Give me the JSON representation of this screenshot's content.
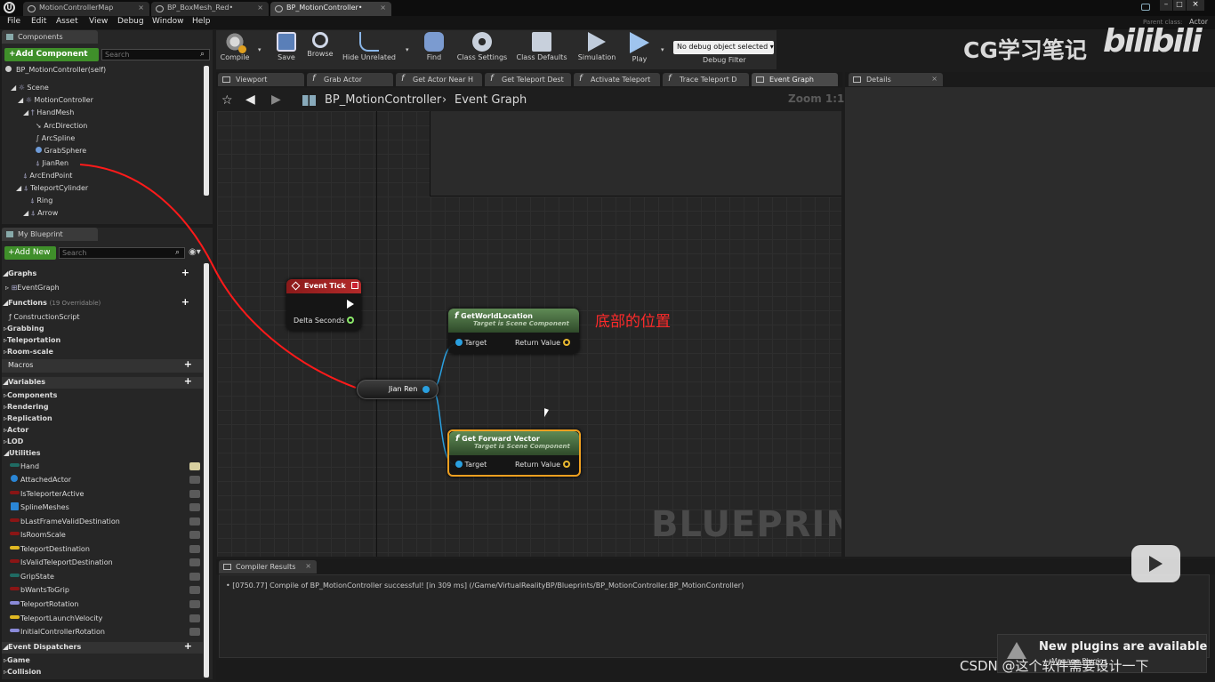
{
  "doc_tabs": [
    "MotionControllerMap",
    "BP_BoxMesh_Red•",
    "BP_MotionController•"
  ],
  "title_right": {
    "parent_class_label": "Parent class:",
    "parent_class_value": "Actor"
  },
  "menu": [
    "File",
    "Edit",
    "Asset",
    "View",
    "Debug",
    "Window",
    "Help"
  ],
  "components": {
    "tab": "Components",
    "add_button": "+Add Component",
    "search_placeholder": "Search",
    "self_label": "BP_MotionController(self)",
    "tree": [
      "Scene",
      "MotionController",
      "HandMesh",
      "ArcDirection",
      "ArcSpline",
      "GrabSphere",
      "JianRen",
      "ArcEndPoint",
      "TeleportCylinder",
      "Ring",
      "Arrow"
    ]
  },
  "my_blueprint": {
    "tab": "My Blueprint",
    "add_button": "+Add New",
    "search_placeholder": "Search",
    "graphs_label": "Graphs",
    "event_graph": "EventGraph",
    "functions_label": "Functions",
    "functions_count": "(19 Overridable)",
    "construction_script": "ConstructionScript",
    "function_categories": [
      "Grabbing",
      "Teleportation",
      "Room-scale"
    ],
    "macros_label": "Macros",
    "variables_label": "Variables",
    "variable_categories": [
      "Components",
      "Rendering",
      "Replication",
      "Actor",
      "LOD",
      "Utilities"
    ],
    "variables": [
      {
        "name": "Hand",
        "color": "#1f6b63"
      },
      {
        "name": "AttachedActor",
        "color": "#2a86d6"
      },
      {
        "name": "IsTeleporterActive",
        "color": "#8a1515"
      },
      {
        "name": "SplineMeshes",
        "color": "#2a86d6"
      },
      {
        "name": "bLastFrameValidDestination",
        "color": "#8a1515"
      },
      {
        "name": "IsRoomScale",
        "color": "#8a1515"
      },
      {
        "name": "TeleportDestination",
        "color": "#e0b822"
      },
      {
        "name": "IsValidTeleportDestination",
        "color": "#8a1515"
      },
      {
        "name": "GripState",
        "color": "#1f6b63"
      },
      {
        "name": "bWantsToGrip",
        "color": "#8a1515"
      },
      {
        "name": "TeleportRotation",
        "color": "#8a8ad8"
      },
      {
        "name": "TeleportLaunchVelocity",
        "color": "#e0b822"
      },
      {
        "name": "InitialControllerRotation",
        "color": "#8a8ad8"
      }
    ],
    "dispatchers_label": "Event Dispatchers",
    "dispatcher_categories": [
      "Game",
      "Collision"
    ]
  },
  "toolbar": {
    "buttons": [
      "Compile",
      "Save",
      "Browse",
      "Hide Unrelated",
      "Find",
      "Class Settings",
      "Class Defaults",
      "Simulation",
      "Play"
    ],
    "debug_select": "No debug object selected",
    "debug_filter": "Debug Filter"
  },
  "editor_tabs": [
    "Viewport",
    "Grab Actor",
    "Get Actor Near H",
    "Get Teleport Dest",
    "Activate Teleport",
    "Trace Teleport D",
    "Event Graph"
  ],
  "details_tab": "Details",
  "breadcrumb": {
    "blueprint": "BP_MotionController",
    "graph": "Event Graph",
    "zoom": "Zoom 1:1"
  },
  "graph": {
    "watermark": "BLUEPRINT",
    "event_tick": {
      "title": "Event Tick",
      "pin": "Delta Seconds"
    },
    "variable_node": "Jian Ren",
    "get_world_location": {
      "title": "GetWorldLocation",
      "subtitle": "Target is Scene Component",
      "in": "Target",
      "out": "Return Value"
    },
    "get_forward_vector": {
      "title": "Get Forward Vector",
      "subtitle": "Target is Scene Component",
      "in": "Target",
      "out": "Return Value"
    },
    "annotation": "底部的位置"
  },
  "compiler": {
    "tab": "Compiler Results",
    "message": "[0750.77] Compile of BP_MotionController successful! [in 309 ms] (/Game/VirtualRealityBP/Blueprints/BP_MotionController.BP_MotionController)"
  },
  "overlays": {
    "brand": "CG学习笔记",
    "bilibili": "bilibili",
    "plugins": "New plugins are available",
    "plugins_sub": "Manage Plugins",
    "csdn": "CSDN @这个软件需要设计一下"
  }
}
